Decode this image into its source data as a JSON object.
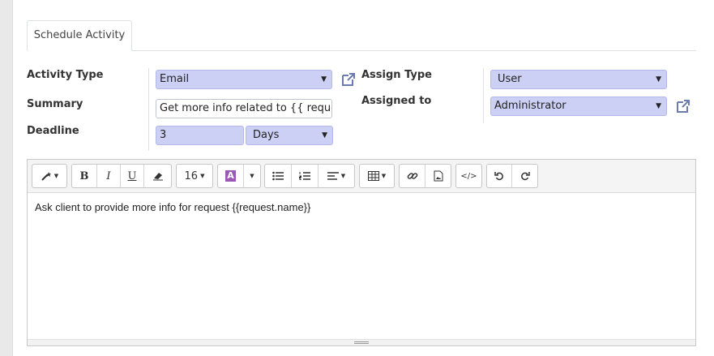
{
  "tab": {
    "label": "Schedule Activity"
  },
  "form": {
    "activity_type": {
      "label": "Activity Type",
      "value": "Email"
    },
    "summary": {
      "label": "Summary",
      "value": "Get more info related to {{ request.na"
    },
    "deadline": {
      "label": "Deadline",
      "value": "3",
      "unit": "Days"
    },
    "assign_type": {
      "label": "Assign Type",
      "value": "User"
    },
    "assigned_to": {
      "label": "Assigned to",
      "value": "Administrator"
    }
  },
  "editor": {
    "font_size": "16",
    "content": "Ask client to provide more info for request {{request.name}}"
  },
  "colors": {
    "field_bg": "#cdd0f5",
    "link_icon": "#6b7bb0"
  }
}
